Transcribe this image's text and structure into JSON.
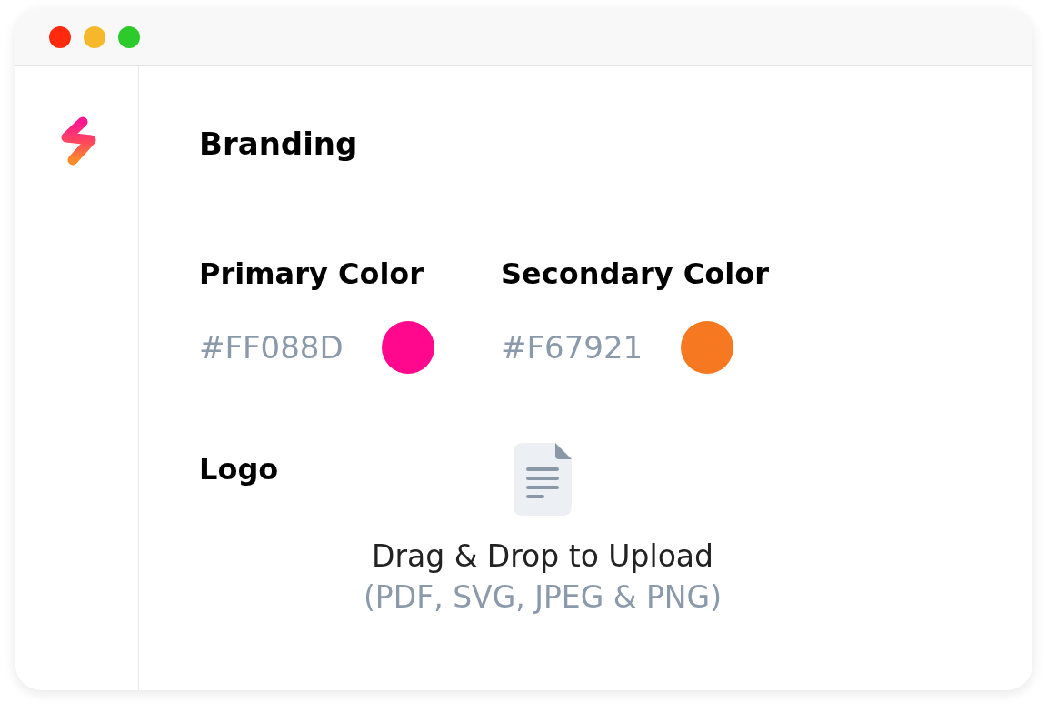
{
  "page": {
    "title": "Branding"
  },
  "colors": [
    {
      "label": "Primary Color",
      "value": "#FF088D",
      "color": "#ff088d"
    },
    {
      "label": "Secondary Color",
      "value": "#F67921",
      "color": "#f67921"
    }
  ],
  "logo": {
    "label": "Logo",
    "upload": {
      "prompt": "Drag & Drop to Upload",
      "formats": "(PDF, SVG, JPEG & PNG)"
    }
  }
}
